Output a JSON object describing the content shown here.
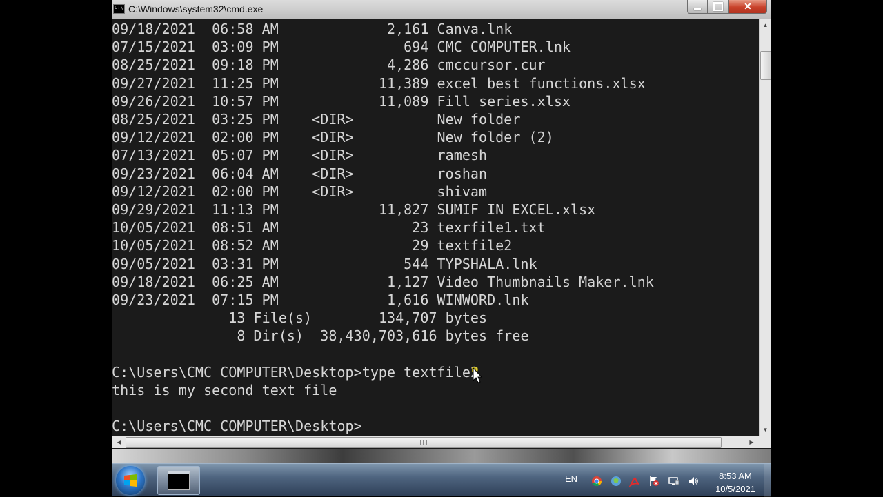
{
  "window": {
    "title": "C:\\Windows\\system32\\cmd.exe",
    "icon_text": "C:\\_"
  },
  "console": {
    "lines": [
      "09/18/2021  06:58 AM             2,161 Canva.lnk",
      "07/15/2021  03:09 PM               694 CMC COMPUTER.lnk",
      "08/25/2021  09:18 PM             4,286 cmccursor.cur",
      "09/27/2021  11:25 PM            11,389 excel best functions.xlsx",
      "09/26/2021  10:57 PM            11,089 Fill series.xlsx",
      "08/25/2021  03:25 PM    <DIR>          New folder",
      "09/12/2021  02:00 PM    <DIR>          New folder (2)",
      "07/13/2021  05:07 PM    <DIR>          ramesh",
      "09/23/2021  06:04 AM    <DIR>          roshan",
      "09/12/2021  02:00 PM    <DIR>          shivam",
      "09/29/2021  11:13 PM            11,827 SUMIF IN EXCEL.xlsx",
      "10/05/2021  08:51 AM                23 texrfile1.txt",
      "10/05/2021  08:52 AM                29 textfile2",
      "09/05/2021  03:31 PM               544 TYPSHALA.lnk",
      "09/18/2021  06:25 AM             1,127 Video Thumbnails Maker.lnk",
      "09/23/2021  07:15 PM             1,616 WINWORD.lnk",
      "              13 File(s)        134,707 bytes",
      "               8 Dir(s)  38,430,703,616 bytes free",
      "",
      "C:\\Users\\CMC COMPUTER\\Desktop>type textfile2",
      "this is my second text file",
      "",
      "C:\\Users\\CMC COMPUTER\\Desktop>"
    ]
  },
  "taskbar": {
    "language": "EN",
    "time": "8:53 AM",
    "date": "10/5/2021"
  },
  "icons": {
    "start": "windows-start-orb",
    "task_cmd": "cmd-taskbar-icon",
    "tray": [
      "chrome-icon",
      "network-icon",
      "acrobat-icon",
      "flag-icon",
      "monitor-icon",
      "volume-icon"
    ]
  }
}
